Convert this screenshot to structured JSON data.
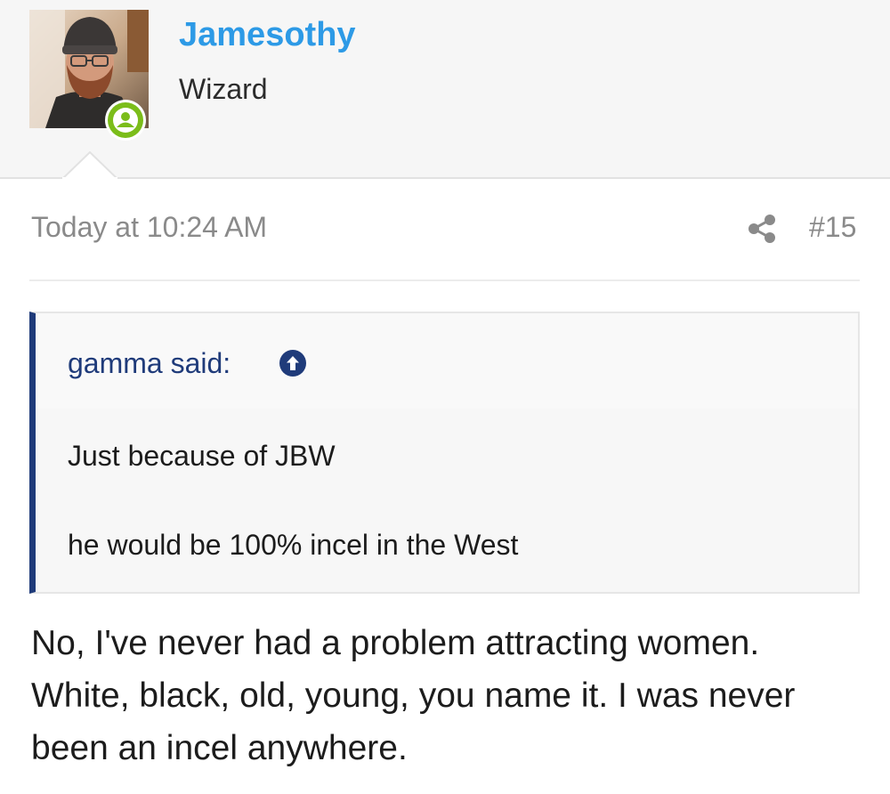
{
  "user": {
    "name": "Jamesothy",
    "title": "Wizard",
    "avatar_alt": "",
    "online_icon": "user-online-icon"
  },
  "post": {
    "date": "Today at 10:24 AM",
    "number": "#15",
    "share_icon": "share-icon"
  },
  "quote": {
    "author": "gamma said:",
    "jump_icon": "arrow-up-circle-icon",
    "lines": [
      "Just because of JBW",
      "he would be 100% incel in the West"
    ]
  },
  "reply": {
    "lines": [
      "No, I've never had a problem attracting women.",
      "White, black, old, young, you name it. I was never",
      "been an incel anywhere."
    ]
  },
  "colors": {
    "username": "#2d9ae6",
    "quote_accent": "#1f3b7a",
    "online": "#7bbd1a"
  }
}
